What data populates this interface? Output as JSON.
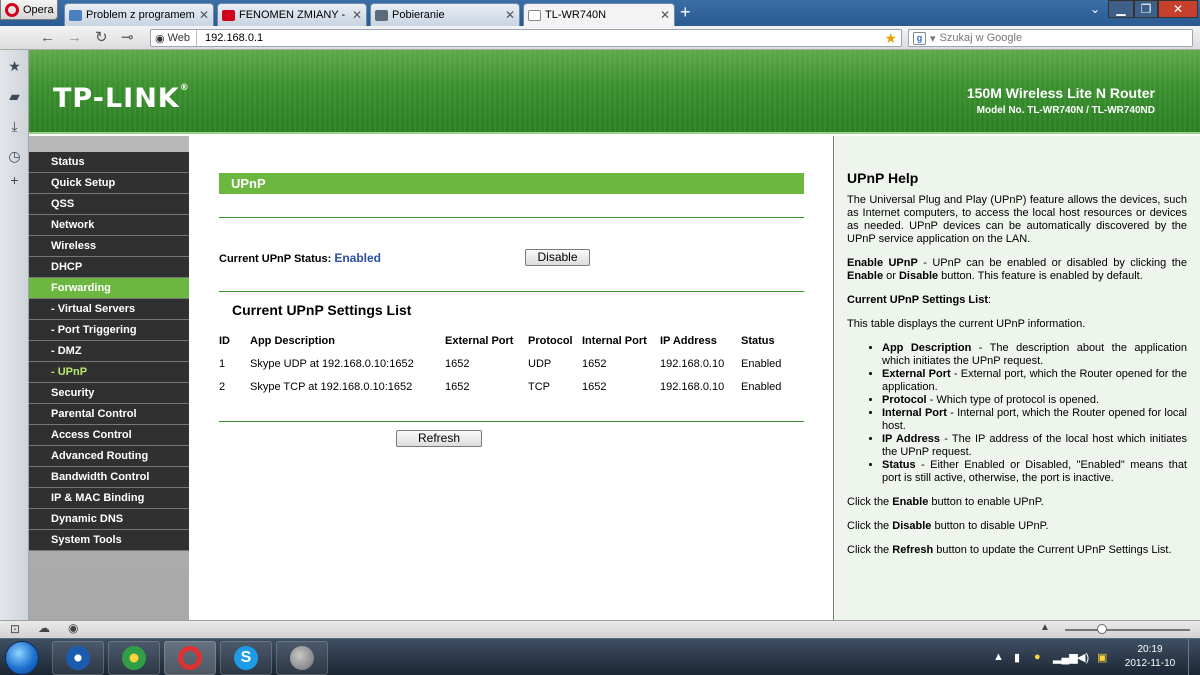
{
  "browser": {
    "menu_label": "Opera",
    "tabs": [
      {
        "title": "Problem z programem ...",
        "icon": "forum-favicon-icon",
        "color": "#4a7fc0"
      },
      {
        "title": "FENOMEN ZMIANY - Y...",
        "icon": "youtube-favicon-icon",
        "color": "#d0021b"
      },
      {
        "title": "Pobieranie",
        "icon": "downloads-favicon-icon",
        "color": "#5b6b7e"
      },
      {
        "title": "TL-WR740N",
        "icon": "page-favicon-icon",
        "color": "#ffffff"
      }
    ],
    "address_badge": "Web",
    "url": "192.168.0.1",
    "search_placeholder": "Szukaj w Google"
  },
  "router": {
    "brand": "TP-LINK",
    "product_name": "150M Wireless Lite N Router",
    "model": "Model No. TL-WR740N / TL-WR740ND",
    "menu": [
      {
        "label": "Status",
        "type": "main"
      },
      {
        "label": "Quick Setup",
        "type": "main"
      },
      {
        "label": "QSS",
        "type": "main"
      },
      {
        "label": "Network",
        "type": "main"
      },
      {
        "label": "Wireless",
        "type": "main"
      },
      {
        "label": "DHCP",
        "type": "main"
      },
      {
        "label": "Forwarding",
        "type": "active"
      },
      {
        "label": "- Virtual Servers",
        "type": "sub"
      },
      {
        "label": "- Port Triggering",
        "type": "sub"
      },
      {
        "label": "- DMZ",
        "type": "sub"
      },
      {
        "label": "- UPnP",
        "type": "subactive"
      },
      {
        "label": "Security",
        "type": "main"
      },
      {
        "label": "Parental Control",
        "type": "main"
      },
      {
        "label": "Access Control",
        "type": "main"
      },
      {
        "label": "Advanced Routing",
        "type": "main"
      },
      {
        "label": "Bandwidth Control",
        "type": "main"
      },
      {
        "label": "IP & MAC Binding",
        "type": "main"
      },
      {
        "label": "Dynamic DNS",
        "type": "main"
      },
      {
        "label": "System Tools",
        "type": "main"
      }
    ]
  },
  "upnp": {
    "title": "UPnP",
    "status_label": "Current UPnP Status:",
    "status_value": "Enabled",
    "disable_button": "Disable",
    "list_title": "Current UPnP Settings List",
    "columns": [
      "ID",
      "App Description",
      "External Port",
      "Protocol",
      "Internal Port",
      "IP Address",
      "Status"
    ],
    "rows": [
      [
        "1",
        "Skype UDP at 192.168.0.10:1652",
        "1652",
        "UDP",
        "1652",
        "192.168.0.10",
        "Enabled"
      ],
      [
        "2",
        "Skype TCP at 192.168.0.10:1652",
        "1652",
        "TCP",
        "1652",
        "192.168.0.10",
        "Enabled"
      ]
    ],
    "refresh_button": "Refresh"
  },
  "help": {
    "title": "UPnP Help",
    "intro": "The Universal Plug and Play (UPnP) feature allows the devices, such as Internet computers, to access the local host resources or devices as needed. UPnP devices can be automatically discovered by the UPnP service application on the LAN.",
    "enable_term": "Enable UPnP",
    "enable_desc_a": " - UPnP can be enabled or disabled by clicking the ",
    "enable_word": "Enable",
    "or_word": " or ",
    "disable_word": "Disable",
    "enable_desc_b": " button. This feature is enabled by default.",
    "list_heading": "Current UPnP Settings List",
    "list_heading_suffix": ":",
    "list_desc": "This table displays the current UPnP information.",
    "bullets": [
      {
        "term": "App Description",
        "desc": " - The description about the application which initiates the UPnP request."
      },
      {
        "term": "External Port",
        "desc": " - External port, which the Router opened for the application."
      },
      {
        "term": "Protocol",
        "desc": " - Which type of protocol is opened."
      },
      {
        "term": "Internal Port",
        "desc": " - Internal port, which the Router opened for local host."
      },
      {
        "term": "IP Address",
        "desc": " - The IP address of the local host which initiates the UPnP request."
      },
      {
        "term": "Status",
        "desc": " - Either Enabled or Disabled, \"Enabled\" means that port is still active, otherwise, the port is inactive."
      }
    ],
    "click_the": "Click the ",
    "click_enable_b": "Enable",
    "click_enable_a": " button to enable UPnP.",
    "click_disable_b": "Disable",
    "click_disable_a": " button to disable UPnP.",
    "click_refresh_b": "Refresh",
    "click_refresh_a": " button to update the Current UPnP Settings List."
  },
  "taskbar": {
    "time": "20:19",
    "date": "2012-11-10"
  }
}
